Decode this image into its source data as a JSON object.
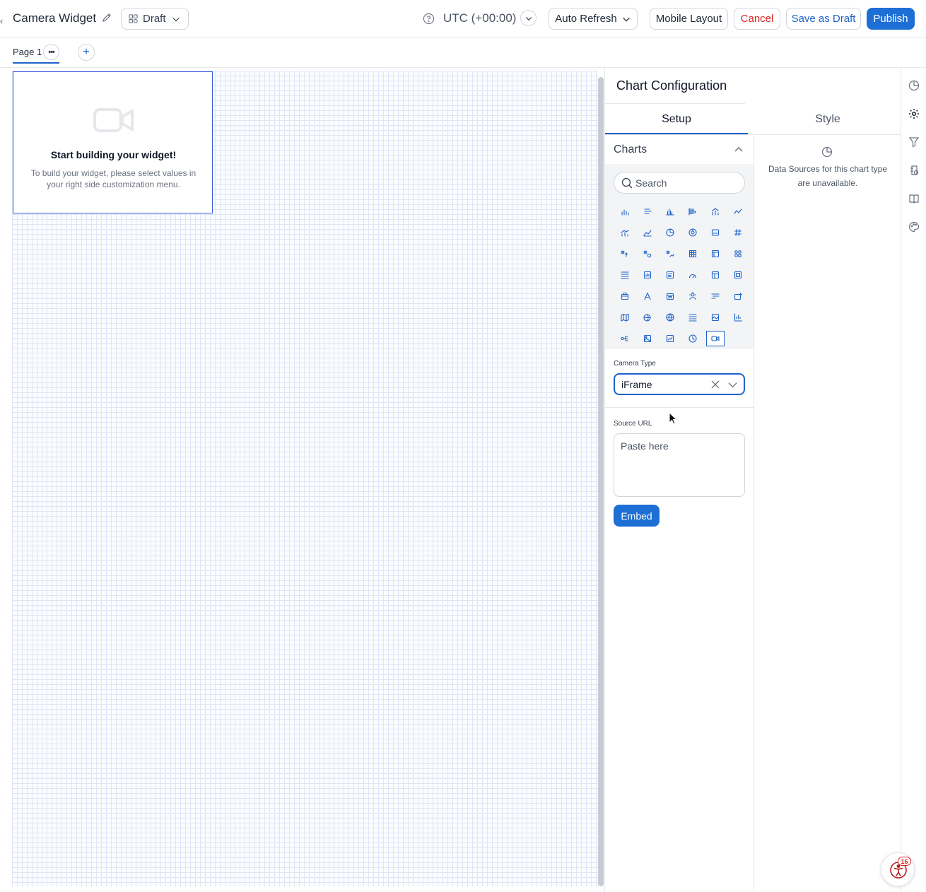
{
  "header": {
    "title": "Camera Widget",
    "status_label": "Draft",
    "timezone": "UTC (+00:00)",
    "auto_refresh_label": "Auto Refresh",
    "mobile_layout_label": "Mobile Layout",
    "cancel_label": "Cancel",
    "save_draft_label": "Save as Draft",
    "publish_label": "Publish"
  },
  "pages": {
    "tabs": [
      {
        "label": "Page 1"
      }
    ],
    "more_label": "•••",
    "add_label": "+"
  },
  "widget": {
    "title": "Start building your widget!",
    "description": "To build your widget, please select values in your right side customization menu."
  },
  "config": {
    "title": "Chart Configuration",
    "tabs": [
      {
        "label": "Setup",
        "active": true
      },
      {
        "label": "Style",
        "active": false
      }
    ],
    "charts_label": "Charts",
    "search_placeholder": "Search",
    "chart_icons": [
      [
        "bar-chart-icon",
        "horizontal-bar-icon",
        "column-chart-icon",
        "stacked-bar-icon",
        "combo-chart-icon",
        "line-chart-icon"
      ],
      [
        "bar-line-icon",
        "area-chart-icon",
        "pie-chart-icon",
        "donut-chart-icon",
        "card-icon",
        "number-icon"
      ],
      [
        "kpi-up-icon",
        "kpi-compare-icon",
        "kpi-trend-icon",
        "table-icon",
        "pivot-table-icon",
        "scorecard-icon"
      ],
      [
        "list-icon",
        "report-icon",
        "text-card-icon",
        "gauge-icon",
        "layout-icon",
        "grid-card-icon"
      ],
      [
        "box-icon",
        "text-icon",
        "calendar-icon",
        "weather-icon",
        "filter-icon",
        "package-icon"
      ],
      [
        "map-icon",
        "globe-pin-icon",
        "globe-icon",
        "legend-icon",
        "image-gallery-icon",
        "axis-chart-icon"
      ],
      [
        "tree-icon",
        "image-icon",
        "picture-chart-icon",
        "clock-icon",
        "camera-icon"
      ]
    ],
    "selected_chart": "camera-icon",
    "camera_type_label": "Camera Type",
    "camera_type_value": "iFrame",
    "source_url_label": "Source URL",
    "source_url_placeholder": "Paste here",
    "embed_label": "Embed",
    "data_sources_message": "Data Sources for this chart type are unavailable."
  },
  "rail": {
    "icons": [
      "chart-type-icon",
      "settings-icon",
      "filter-icon",
      "data-source-icon",
      "book-icon",
      "palette-icon"
    ]
  },
  "accessibility": {
    "badge_count": "16"
  },
  "colors": {
    "accent": "#1d63c9",
    "primary_button": "#1d6fd6",
    "danger": "#dc2626",
    "widget_border": "#3b5bdb",
    "grid_line": "#dfe5f5"
  }
}
